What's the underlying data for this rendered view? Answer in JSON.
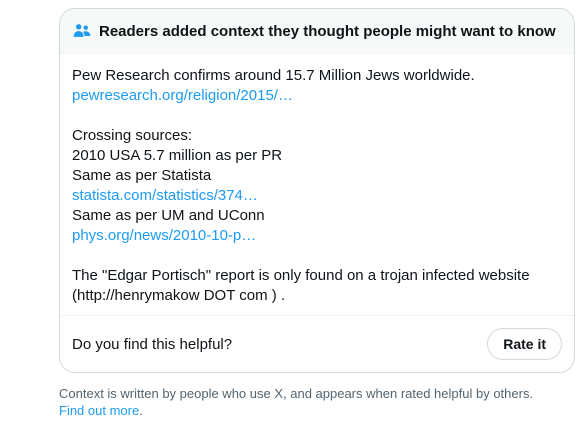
{
  "note": {
    "header_icon": "people-group-icon",
    "header_title": "Readers added context they thought people might want to know",
    "body_lines": [
      {
        "text": "Pew Research confirms around 15.7 Million Jews worldwide.",
        "type": "text"
      },
      {
        "text": "pewresearch.org/religion/2015/…",
        "type": "link"
      },
      {
        "text": "",
        "type": "spacer"
      },
      {
        "text": "Crossing sources:",
        "type": "text"
      },
      {
        "text": "2010 USA 5.7 million as per PR",
        "type": "text"
      },
      {
        "text": "Same as per Statista",
        "type": "text"
      },
      {
        "text": "statista.com/statistics/374…",
        "type": "link"
      },
      {
        "text": "Same as per UM and UConn",
        "type": "text"
      },
      {
        "text": "phys.org/news/2010-10-p…",
        "type": "link"
      },
      {
        "text": "",
        "type": "spacer"
      },
      {
        "text": "The \"Edgar Portisch\" report is only found on a trojan infected website",
        "type": "text"
      },
      {
        "text": "(http://henrymakow DOT com ) .",
        "type": "text"
      }
    ],
    "footer": {
      "question": "Do you find this helpful?",
      "rate_button": "Rate it"
    }
  },
  "disclaimer": {
    "text": "Context is written by people who use X, and appears when rated helpful by others.",
    "link": "Find out more",
    "trailing": "."
  },
  "colors": {
    "link": "#1d9bf0",
    "text": "#0f1419",
    "muted": "#536471",
    "border": "#cfd9de",
    "header_bg": "#f7f9f9"
  }
}
